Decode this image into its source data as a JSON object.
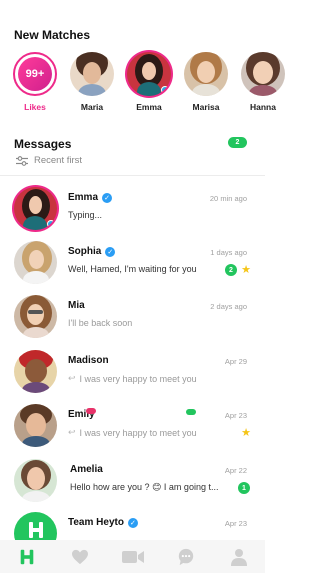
{
  "new_matches": {
    "title": "New Matches",
    "likes": {
      "count": "99+",
      "label": "Likes"
    },
    "items": [
      {
        "name": "Maria"
      },
      {
        "name": "Emma"
      },
      {
        "name": "Marisa"
      },
      {
        "name": "Hanna"
      }
    ]
  },
  "messages": {
    "title": "Messages",
    "badge": "2",
    "sort_label": "Recent first",
    "rows": [
      {
        "name": "Emma",
        "time": "20 min ago",
        "message": "Typing..."
      },
      {
        "name": "Sophia",
        "time": "1 days ago",
        "message": "Well, Hamed, I'm waiting for you",
        "unread": "2"
      },
      {
        "name": "Mia",
        "time": "2 days ago",
        "message": "I'll be back soon"
      },
      {
        "name": "Madison",
        "time": "Apr 29",
        "message": "I was very happy to meet you"
      },
      {
        "name": "Emily",
        "time": "Apr 23",
        "message": "I was very happy to meet you"
      },
      {
        "name": "Amelia",
        "time": "Apr 22",
        "message": "Hello how are you ? 😊 I am going t...",
        "unread": "1"
      },
      {
        "name": "Team Heyto",
        "time": "Apr 23",
        "message": ""
      }
    ]
  },
  "colors": {
    "accent_pink": "#ee2a8a",
    "green": "#22c55e",
    "verified_blue": "#2a9df4",
    "star": "#f5c518"
  },
  "tabs": [
    {
      "icon": "home-logo-icon"
    },
    {
      "icon": "heart-icon"
    },
    {
      "icon": "video-icon"
    },
    {
      "icon": "chat-icon"
    },
    {
      "icon": "profile-icon"
    }
  ]
}
